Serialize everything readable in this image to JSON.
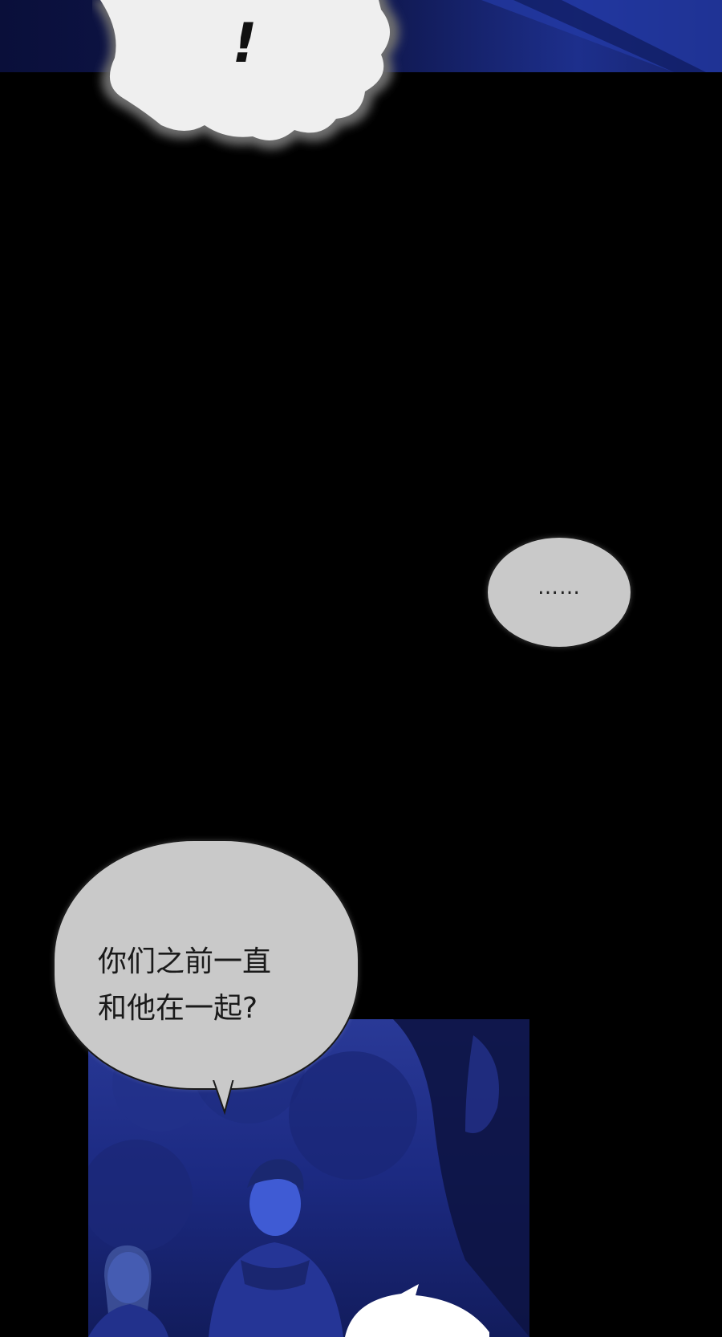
{
  "scene": {
    "background_color": "#000000",
    "night_blue": "#1e2f8a",
    "bubble_gray": "#c9c9c9"
  },
  "bubbles": {
    "exclaim": {
      "text": "!"
    },
    "ellipsis": {
      "text": "……"
    },
    "speech": {
      "text": "你们之前一直\n和他在一起?"
    }
  }
}
